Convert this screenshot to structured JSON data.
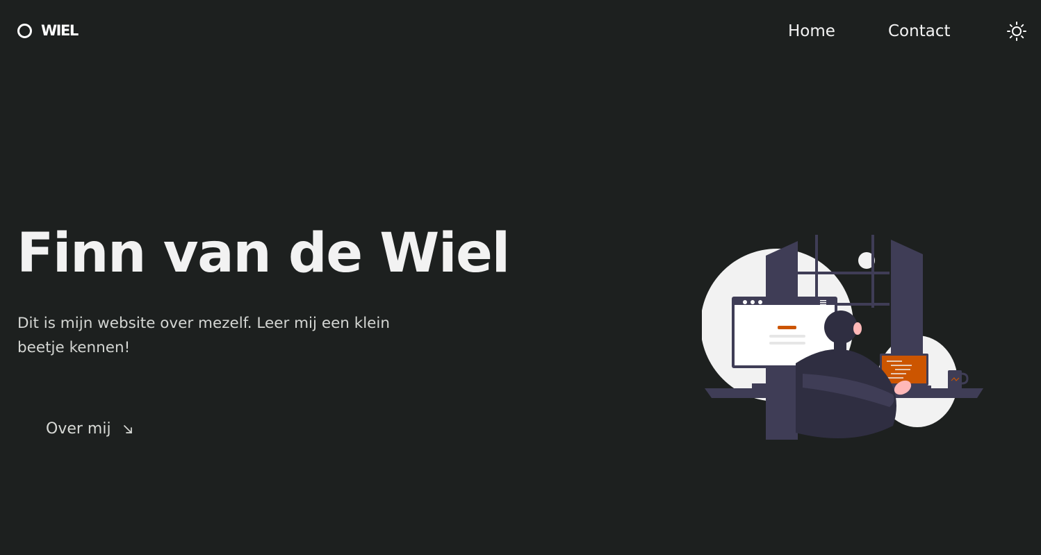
{
  "brand": {
    "name": "WIEL"
  },
  "nav": {
    "home_label": "Home",
    "contact_label": "Contact",
    "theme_icon": "sun-icon"
  },
  "hero": {
    "title": "Finn van de Wiel",
    "description": "Dit is mijn website over mezelf. Leer mij een klein beetje kennen!",
    "cta_label": "Over mij",
    "cta_icon": "arrow-down-right-icon"
  },
  "illustration": {
    "subject": "person-at-computer-illustration"
  },
  "colors": {
    "background": "#1d201f",
    "text": "#f2f2f2",
    "muted_text": "#d4d6d3",
    "accent": "#cc5500",
    "illustration_dark": "#3f3d56",
    "illustration_light": "#f2f2f2"
  }
}
